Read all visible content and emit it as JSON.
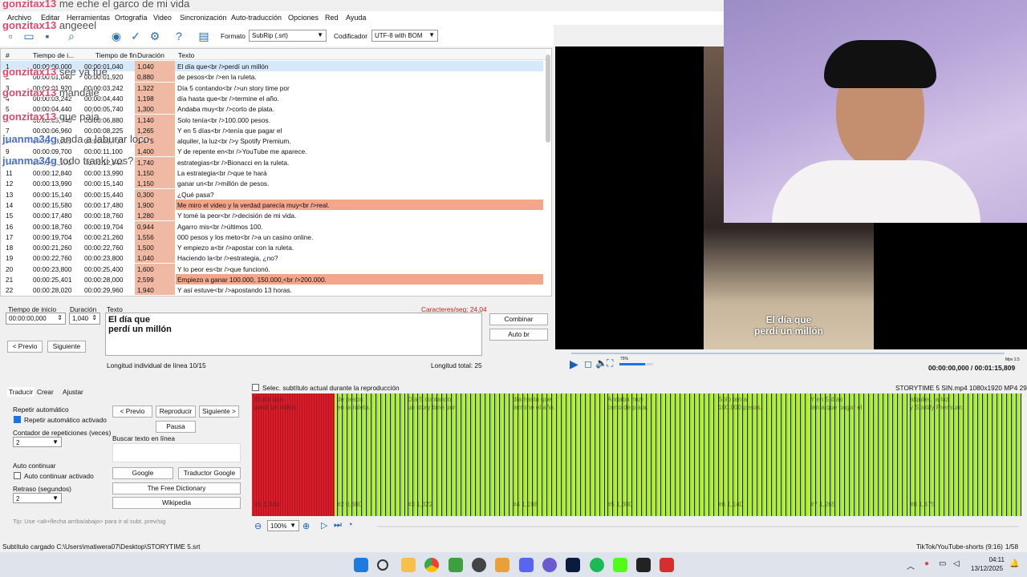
{
  "menu": [
    "Archivo",
    "Editar",
    "Herramientas",
    "Ortografía",
    "Video",
    "Sincronización",
    "Auto-traducción",
    "Opciones",
    "Red",
    "Ayuda"
  ],
  "toolbar": {
    "format_label": "Formato",
    "format_value": "SubRip (.srt)",
    "encoding_label": "Codificador",
    "encoding_value": "UTF-8 with BOM"
  },
  "grid": {
    "headers": {
      "num": "#",
      "start": "Tiempo de i...",
      "end": "Tiempo de fin",
      "duration": "Duración",
      "text": "Texto"
    },
    "rows": [
      {
        "n": "1",
        "start": "00:00:00,000",
        "end": "00:00:01,040",
        "dur": "1,040",
        "text": "El día que<br />perdí un millón"
      },
      {
        "n": "2",
        "start": "00:00:01,040",
        "end": "00:00:01,920",
        "dur": "0,880",
        "text": "de pesos<br />en la ruleta."
      },
      {
        "n": "3",
        "start": "00:00:01,920",
        "end": "00:00:03,242",
        "dur": "1,322",
        "text": "Día 5 contando<br />un story time por"
      },
      {
        "n": "4",
        "start": "00:00:03,242",
        "end": "00:00:04,440",
        "dur": "1,198",
        "text": "día hasta que<br />termine el año."
      },
      {
        "n": "5",
        "start": "00:00:04,440",
        "end": "00:00:05,740",
        "dur": "1,300",
        "text": "Andaba muy<br />corto de plata."
      },
      {
        "n": "6",
        "start": "00:00:05,740",
        "end": "00:00:06,880",
        "dur": "1,140",
        "text": "Solo tenía<br />100.000 pesos."
      },
      {
        "n": "7",
        "start": "00:00:06,960",
        "end": "00:00:08,225",
        "dur": "1,265",
        "text": "Y en 5 días<br />tenía que pagar el"
      },
      {
        "n": "8",
        "start": "00:00:08,225",
        "end": "00:00:09,700",
        "dur": "1,475",
        "text": "alquiler, la luz<br />y Spotify Premium."
      },
      {
        "n": "9",
        "start": "00:00:09,700",
        "end": "00:00:11,100",
        "dur": "1,400",
        "text": "Y de repente en<br />YouTube me aparece."
      },
      {
        "n": "10",
        "start": "00:00:11,100",
        "end": "00:00:12,840",
        "dur": "1,740",
        "text": "estrategias<br />Bionacci en la ruleta."
      },
      {
        "n": "11",
        "start": "00:00:12,840",
        "end": "00:00:13,990",
        "dur": "1,150",
        "text": "La estrategia<br />que te hará"
      },
      {
        "n": "12",
        "start": "00:00:13,990",
        "end": "00:00:15,140",
        "dur": "1,150",
        "text": "ganar un<br />millón de pesos."
      },
      {
        "n": "13",
        "start": "00:00:15,140",
        "end": "00:00:15,440",
        "dur": "0,300",
        "text": "¿Qué pasa?"
      },
      {
        "n": "14",
        "start": "00:00:15,580",
        "end": "00:00:17,480",
        "dur": "1,900",
        "text": "Me miro el video y la verdad parecía muy<br />real."
      },
      {
        "n": "15",
        "start": "00:00:17,480",
        "end": "00:00:18,760",
        "dur": "1,280",
        "text": "Y tomé la peor<br />decisión de mi vida."
      },
      {
        "n": "16",
        "start": "00:00:18,760",
        "end": "00:00:19,704",
        "dur": "0,944",
        "text": "Agarro mis<br />últimos 100."
      },
      {
        "n": "17",
        "start": "00:00:19,704",
        "end": "00:00:21,260",
        "dur": "1,556",
        "text": "000 pesos y los meto<br />a un casino online."
      },
      {
        "n": "18",
        "start": "00:00:21,260",
        "end": "00:00:22,760",
        "dur": "1,500",
        "text": "Y empiezo a<br />apostar con la ruleta."
      },
      {
        "n": "19",
        "start": "00:00:22,760",
        "end": "00:00:23,800",
        "dur": "1,040",
        "text": "Haciendo la<br />estrategia, ¿no?"
      },
      {
        "n": "20",
        "start": "00:00:23,800",
        "end": "00:00:25,400",
        "dur": "1,600",
        "text": "Y lo peor es<br />que funcionó."
      },
      {
        "n": "21",
        "start": "00:00:25,401",
        "end": "00:00:28,000",
        "dur": "2,599",
        "text": "Empiezo a ganar 100.000, 150.000,<br />200.000."
      },
      {
        "n": "22",
        "start": "00:00:28,020",
        "end": "00:00:29,960",
        "dur": "1,940",
        "text": "Y así estuve<br />apostando 13 horas."
      }
    ]
  },
  "editor": {
    "start_label": "Tiempo de inicio",
    "start_value": "00:00:00,000",
    "dur_label": "Duración",
    "dur_value": "1,040",
    "text_label": "Texto",
    "cps": "Caracteres/seg: 24,04",
    "text_line1": "El día que",
    "text_line2": "perdí un millón",
    "prev": "< Previo",
    "next": "Siguiente",
    "combine": "Combinar",
    "autobr": "Auto br",
    "line_len": "Longitud individual de línea 10/15",
    "total_len": "Longitud total: 25"
  },
  "video": {
    "sub1": "El día que",
    "sub2": "perdí un millón",
    "time": "00:00:00,000 / 00:01:15,809",
    "file_info": "STORYTIME 5 SIN.mp4 1080x1920 MP4 29,97",
    "volume": "75%",
    "mpv": "Mpv 2.5"
  },
  "translate": {
    "tabs": [
      "Traducir",
      "Crear",
      "Ajustar"
    ],
    "repeat_title": "Repetir automático",
    "repeat_on": "Repetir automático activado",
    "repeat_count_label": "Contador de repeticiones (veces)",
    "repeat_count": "2",
    "auto_title": "Auto continuar",
    "auto_on": "Auto continuar activado",
    "delay_label": "Retraso (segundos)",
    "delay": "2",
    "prev": "< Previo",
    "play_current": "Reproducir",
    "next": "Siguiente >",
    "pause": "Pausa",
    "search_label": "Buscar texto en línea",
    "google": "Google",
    "gtranslate": "Traductor Google",
    "freedict": "The Free Dictionary",
    "wiki": "Wikipedia",
    "tip": "Tip: Use <alt+flecha arriba/abajo> para ir al subt. prev/sig",
    "sel_current": "Selec. subtítulo actual durante la reproducción"
  },
  "waveform": {
    "zoom": "100%",
    "segments": [
      {
        "t1": "El día que",
        "t2": "perdí un millón",
        "label": "#1 1,040"
      },
      {
        "t1": "de pesos",
        "t2": "en la ruleta.",
        "label": "#2 0,880"
      },
      {
        "t1": "Día 5 contando",
        "t2": "un story time por",
        "label": "#3 1,322"
      },
      {
        "t1": "día hasta que",
        "t2": "termine el año.",
        "label": "#4 1,198"
      },
      {
        "t1": "Andaba muy",
        "t2": "corto de plata.",
        "label": "#5 1,300"
      },
      {
        "t1": "Solo tenía",
        "t2": "100.000 pesos.",
        "label": "#6 1,140"
      },
      {
        "t1": "Y en 5 días",
        "t2": "tenía que pagar el",
        "label": "#7 1,265"
      },
      {
        "t1": "alquiler, la luz",
        "t2": "y Spotify Premium.",
        "label": "#8 1,475"
      }
    ]
  },
  "chat": [
    {
      "name": "gonzitax13",
      "msg": "me eche el garco de mi vida"
    },
    {
      "name": "gonzitax13",
      "msg": "angeeel"
    },
    {
      "name": "gonzitax13",
      "msg": "see ya fue"
    },
    {
      "name": "gonzitax13",
      "msg": "mandale"
    },
    {
      "name": "gonzitax13",
      "msg": "que paja"
    },
    {
      "name": "juanma34g",
      "msg": "anda a laburar loco"
    },
    {
      "name": "juanma34g",
      "msg": "todo tranki vos?"
    }
  ],
  "status": {
    "left": "Subtítulo cargado C:\\Users\\matiwera07\\Desktop\\STORYTIME 5.srt",
    "right_profile": "TikTok/YouTube-shorts (9:16)",
    "position": "1/58"
  },
  "taskbar": {
    "time": "04:11",
    "date": "13/12/2025"
  }
}
